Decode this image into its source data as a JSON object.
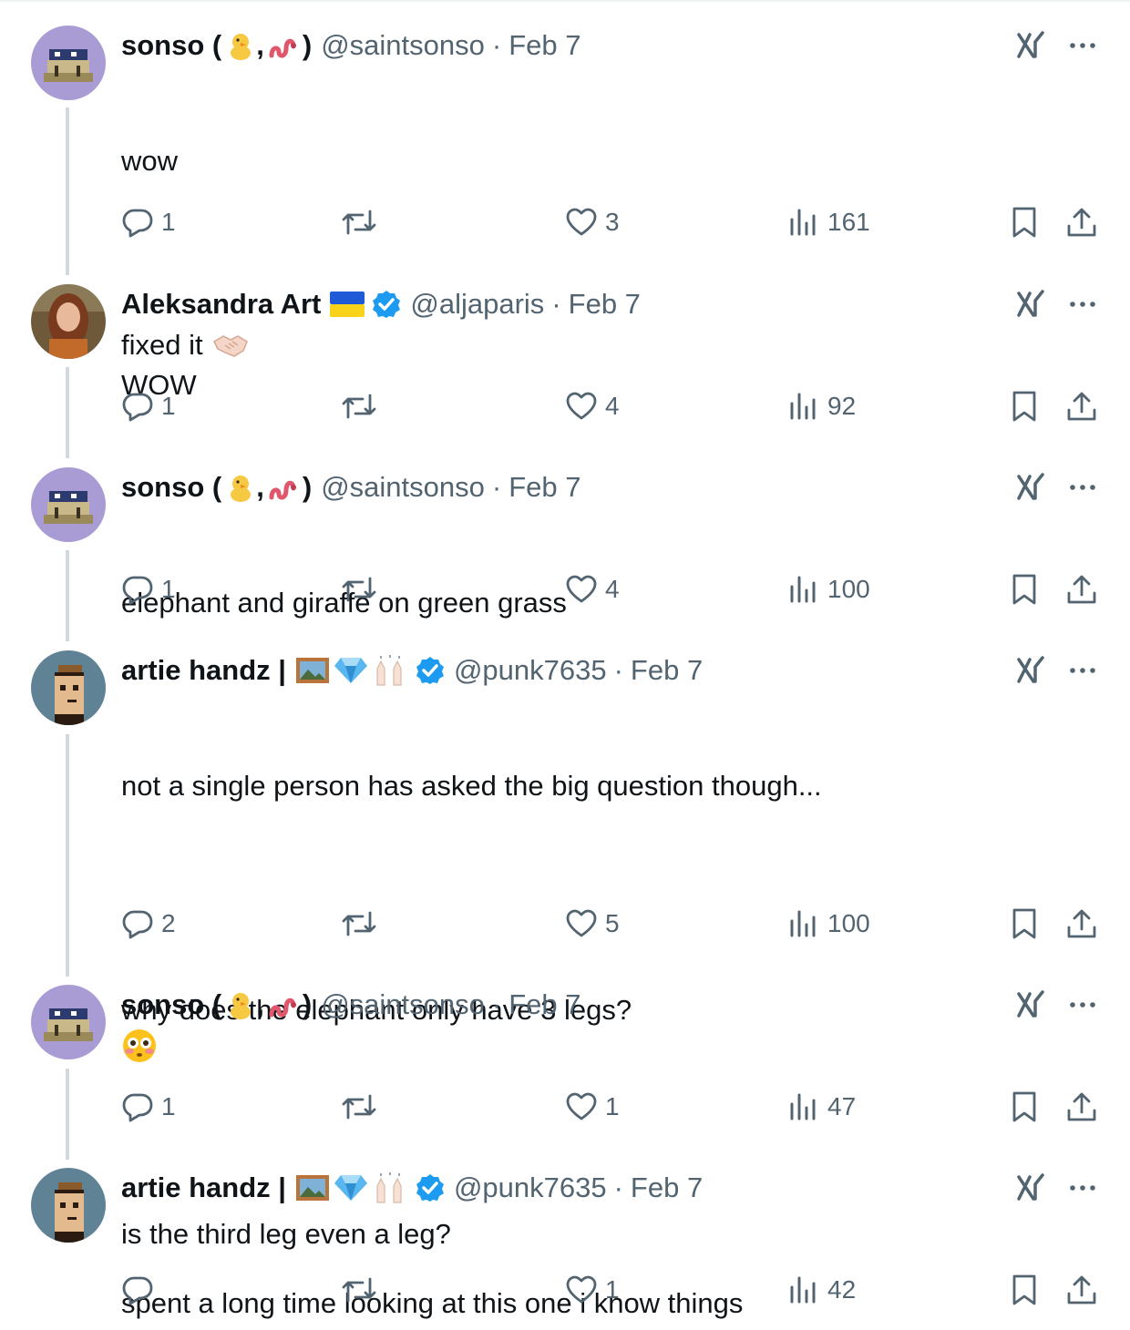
{
  "tweets": [
    {
      "name": "sonso (",
      "name_close": ")",
      "handle": "@saintsonso",
      "date": "Feb 7",
      "lines": [
        "wow",
        "",
        "WOW"
      ],
      "replies": "1",
      "reposts": "",
      "likes": "3",
      "views": "161"
    },
    {
      "name": "Aleksandra Art",
      "handle": "@aljaparis",
      "date": "Feb 7",
      "lines": [
        "fixed it"
      ],
      "replies": "1",
      "reposts": "",
      "likes": "4",
      "views": "92"
    },
    {
      "name": "sonso (",
      "name_close": ")",
      "handle": "@saintsonso",
      "date": "Feb 7",
      "lines": [
        "elephant and giraffe on green grass"
      ],
      "replies": "1",
      "reposts": "",
      "likes": "4",
      "views": "100"
    },
    {
      "name": "artie handz |",
      "handle": "@punk7635",
      "date": "Feb 7",
      "lines": [
        "not a single person has asked the big question though...",
        "",
        "why does the elephant only have 3 legs?",
        "",
        "is the third leg even a leg?"
      ],
      "replies": "2",
      "reposts": "",
      "likes": "5",
      "views": "100"
    },
    {
      "name": "sonso (",
      "name_close": ")",
      "handle": "@saintsonso",
      "date": "Feb 7",
      "lines": [],
      "replies": "1",
      "reposts": "",
      "likes": "1",
      "views": "47"
    },
    {
      "name": "artie handz |",
      "handle": "@punk7635",
      "date": "Feb 7",
      "lines": [
        "spent a long time looking at this one i know things"
      ],
      "replies": "",
      "reposts": "",
      "likes": "1",
      "views": "42"
    }
  ],
  "separator": "·",
  "icons": {
    "reply": "reply-icon",
    "repost": "repost-icon",
    "like": "heart-icon",
    "views": "views-icon",
    "bookmark": "bookmark-icon",
    "share": "share-icon",
    "grok": "grok-icon",
    "more": "more-icon",
    "verified": "verified-badge-icon"
  },
  "colors": {
    "text": "#0f1419",
    "secondary": "#536471",
    "verified": "#1d9bf0",
    "thread_line": "#cfd9de"
  }
}
